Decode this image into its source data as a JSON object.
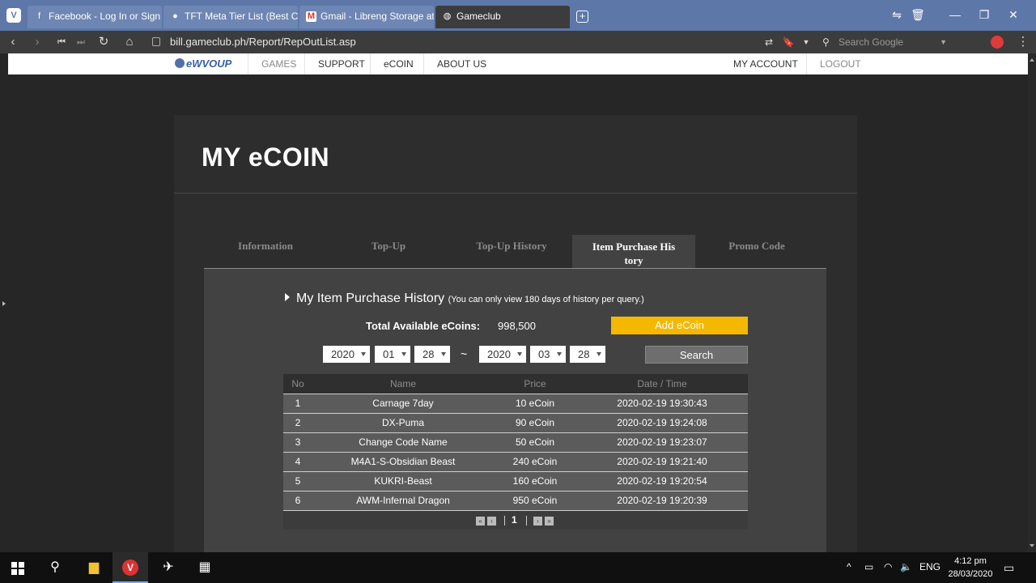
{
  "browser": {
    "tabs": [
      {
        "title": "Facebook - Log In or Sign Up",
        "icon": "facebook-icon"
      },
      {
        "title": "TFT Meta Tier List (Best Comps)",
        "icon": "tft-icon"
      },
      {
        "title": "Gmail - Libreng Storage at Email",
        "icon": "gmail-icon"
      },
      {
        "title": "Gameclub",
        "icon": "gameclub-icon"
      }
    ],
    "url": "bill.gameclub.ph/Report/RepOutList.asp",
    "search_placeholder": "Search Google"
  },
  "site_nav": {
    "logo_text": "eWVOUP",
    "items": [
      "GAMES",
      "SUPPORT",
      "eCOIN",
      "ABOUT US"
    ],
    "account": "MY ACCOUNT",
    "logout": "LOGOUT"
  },
  "page": {
    "title": "MY eCOIN",
    "tabs": [
      "Information",
      "Top-Up",
      "Top-Up History",
      "Item Purchase History",
      "Promo Code"
    ],
    "active_tab_line1": "Item Purchase His",
    "active_tab_line2": "tory",
    "section_title": "My Item Purchase History",
    "section_note": "(You can only view 180 days of history per query.)",
    "balance_label": "Total Available eCoins:",
    "balance_value": "998,500",
    "add_button": "Add eCoin",
    "date_from": {
      "year": "2020",
      "month": "01",
      "day": "28"
    },
    "date_to": {
      "year": "2020",
      "month": "03",
      "day": "28"
    },
    "range_separator": "~",
    "search_button": "Search"
  },
  "table": {
    "headers": [
      "No",
      "Name",
      "Price",
      "Date / Time"
    ],
    "rows": [
      [
        "1",
        "Carnage 7day",
        "10 eCoin",
        "2020-02-19 19:30:43"
      ],
      [
        "2",
        "DX-Puma",
        "90 eCoin",
        "2020-02-19 19:24:08"
      ],
      [
        "3",
        "Change Code Name",
        "50 eCoin",
        "2020-02-19 19:23:07"
      ],
      [
        "4",
        "M4A1-S-Obsidian Beast",
        "240 eCoin",
        "2020-02-19 19:21:40"
      ],
      [
        "5",
        "KUKRI-Beast",
        "160 eCoin",
        "2020-02-19 19:20:54"
      ],
      [
        "6",
        "AWM-Infernal Dragon",
        "950 eCoin",
        "2020-02-19 19:20:39"
      ]
    ],
    "current_page": "1"
  },
  "taskbar": {
    "lang": "ENG",
    "time": "4:12 pm",
    "date": "28/03/2020"
  },
  "colors": {
    "accent_yellow": "#f5b800",
    "tab_bar": "#5d77a8",
    "panel": "#2d2d2d",
    "content": "#424242"
  }
}
